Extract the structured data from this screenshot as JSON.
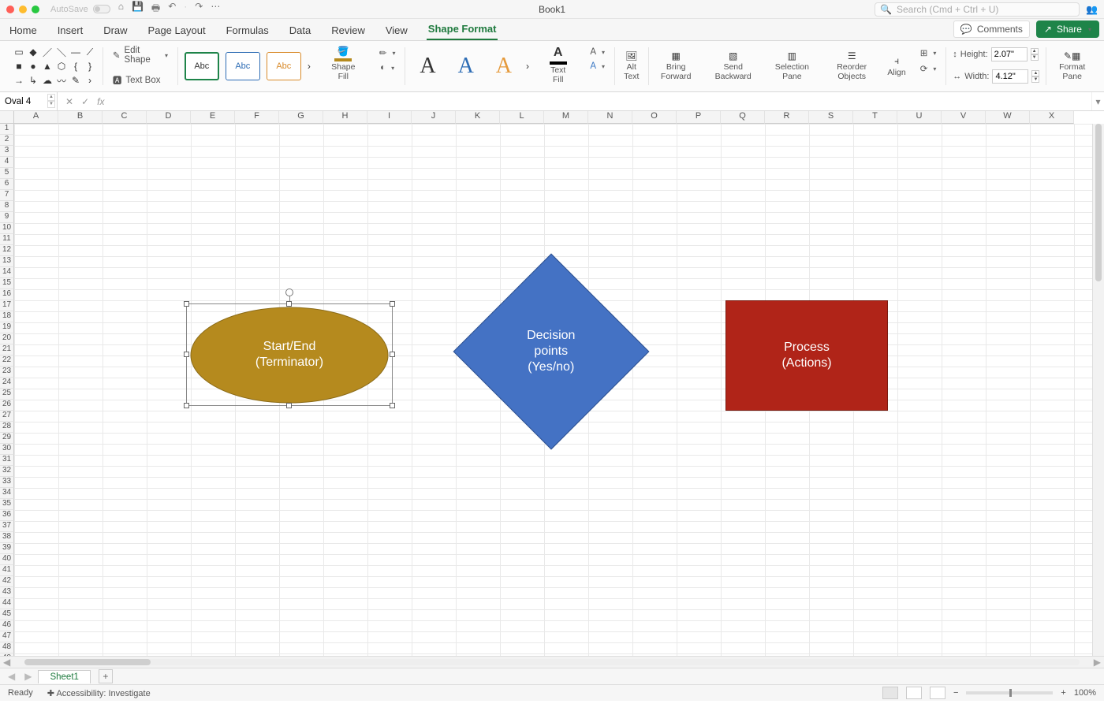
{
  "titlebar": {
    "autosave": "AutoSave",
    "doc": "Book1",
    "search_placeholder": "Search (Cmd + Ctrl + U)"
  },
  "tabs": {
    "items": [
      "Home",
      "Insert",
      "Draw",
      "Page Layout",
      "Formulas",
      "Data",
      "Review",
      "View",
      "Shape Format"
    ],
    "active": "Shape Format",
    "comments": "Comments",
    "share": "Share"
  },
  "ribbon": {
    "edit_shape": "Edit Shape",
    "text_box": "Text Box",
    "style_label": "Abc",
    "shape_fill": "Shape Fill",
    "text_fill": "Text Fill",
    "alt_text": "Alt Text",
    "bring_forward": "Bring Forward",
    "send_backward": "Send Backward",
    "selection_pane": "Selection Pane",
    "reorder_objects": "Reorder Objects",
    "align": "Align",
    "height_lbl": "Height:",
    "width_lbl": "Width:",
    "height_val": "2.07\"",
    "width_val": "4.12\"",
    "format_pane": "Format Pane"
  },
  "namebox": "Oval 4",
  "columns": [
    "A",
    "B",
    "C",
    "D",
    "E",
    "F",
    "G",
    "H",
    "I",
    "J",
    "K",
    "L",
    "M",
    "N",
    "O",
    "P",
    "Q",
    "R",
    "S",
    "T",
    "U",
    "V",
    "W",
    "X"
  ],
  "shapes": {
    "oval_line1": "Start/End",
    "oval_line2": "(Terminator)",
    "diamond_line1": "Decision",
    "diamond_line2": "points",
    "diamond_line3": "(Yes/no)",
    "rect_line1": "Process",
    "rect_line2": "(Actions)"
  },
  "sheets": {
    "s1": "Sheet1"
  },
  "status": {
    "ready": "Ready",
    "accessibility": "Accessibility: Investigate",
    "zoom": "100%"
  }
}
